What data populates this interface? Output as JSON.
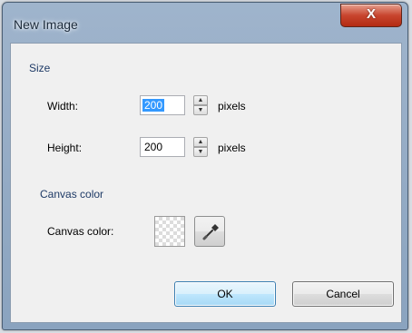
{
  "window": {
    "title": "New Image",
    "close_glyph": "X"
  },
  "size_section": {
    "label": "Size",
    "width": {
      "label": "Width:",
      "value": "200",
      "unit": "pixels",
      "selected": true
    },
    "height": {
      "label": "Height:",
      "value": "200",
      "unit": "pixels"
    }
  },
  "canvas_section": {
    "label": "Canvas color",
    "color_label": "Canvas color:",
    "swatch": "transparent-checkerboard",
    "picker_icon": "eyedropper-icon"
  },
  "buttons": {
    "ok_label": "OK",
    "cancel_label": "Cancel"
  },
  "colors": {
    "title_bar": "#9fb4cc",
    "close_button": "#c8452e",
    "section_header": "#1e3a66",
    "selection": "#3399ff",
    "ok_border": "#3c7fb1"
  }
}
